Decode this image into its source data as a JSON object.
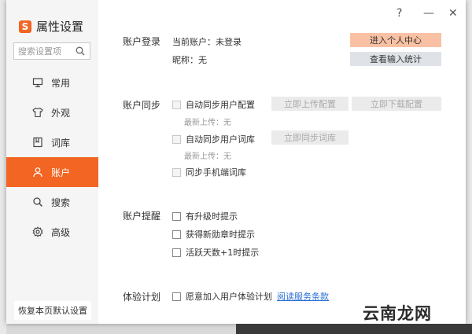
{
  "app": {
    "logo_letter": "S",
    "title": "属性设置"
  },
  "titlebar": {
    "help": "?",
    "minimize": "—",
    "close": "✕"
  },
  "search": {
    "placeholder": "搜索设置项"
  },
  "nav": [
    {
      "label": "常用",
      "icon": "monitor-icon"
    },
    {
      "label": "外观",
      "icon": "shirt-icon"
    },
    {
      "label": "词库",
      "icon": "book-icon"
    },
    {
      "label": "账户",
      "icon": "user-icon",
      "active": true
    },
    {
      "label": "搜索",
      "icon": "search-icon"
    },
    {
      "label": "高级",
      "icon": "gear-icon"
    }
  ],
  "restore_label": "恢复本页默认设置",
  "account_login": {
    "section": "账户登录",
    "current_account": "当前账户：未登录",
    "nickname": "昵称：无",
    "btn_personal_center": "进入个人中心",
    "btn_view_stats": "查看输入统计"
  },
  "account_sync": {
    "section": "账户同步",
    "auto_sync_config": "自动同步用户配置",
    "btn_upload_config": "立即上传配置",
    "btn_download_config": "立即下载配置",
    "last_upload_1": "最新上传：无",
    "auto_sync_dict": "自动同步用户词库",
    "btn_sync_dict": "立即同步词库",
    "last_upload_2": "最新上传：无",
    "sync_mobile_dict": "同步手机端词库"
  },
  "account_reminder": {
    "section": "账户提醒",
    "upgrade": "有升级时提示",
    "new_badge": "获得新勋章时提示",
    "active_days": "活跃天数+1时提示"
  },
  "experience": {
    "section": "体验计划",
    "join": "愿意加入用户体验计划",
    "terms_link": "阅读服务条款"
  },
  "watermark": "云南龙网",
  "colors": {
    "accent": "#f26522",
    "primary_btn": "#f9c1a3",
    "link": "#2a6fd6"
  }
}
